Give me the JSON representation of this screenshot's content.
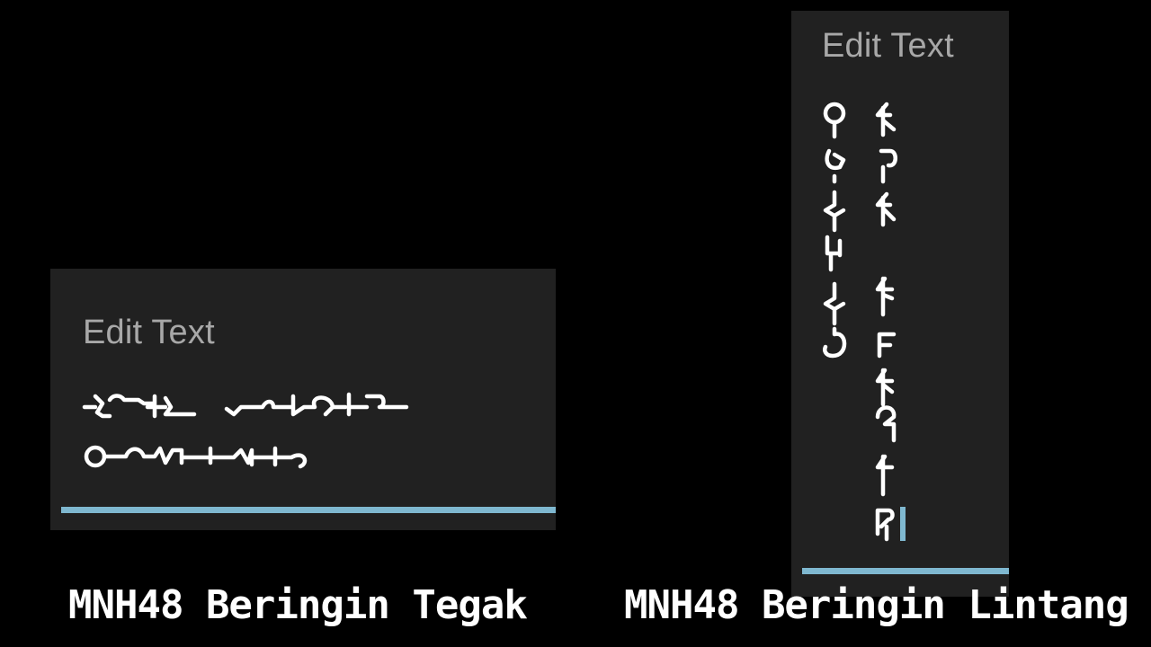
{
  "colors": {
    "background": "#000000",
    "panel": "#212121",
    "hint": "#a8a8a8",
    "accent": "#7fb8d0",
    "glyph": "#ffffff",
    "caption": "#ffffff"
  },
  "left_panel": {
    "hint": "Edit Text",
    "content_icon": "mnh48-horizontal-script-text"
  },
  "right_panel": {
    "hint": "Edit Text",
    "content_icon": "mnh48-vertical-script-text"
  },
  "captions": {
    "left": "MNH48 Beringin Tegak",
    "right": "MNH48 Beringin Lintang"
  }
}
